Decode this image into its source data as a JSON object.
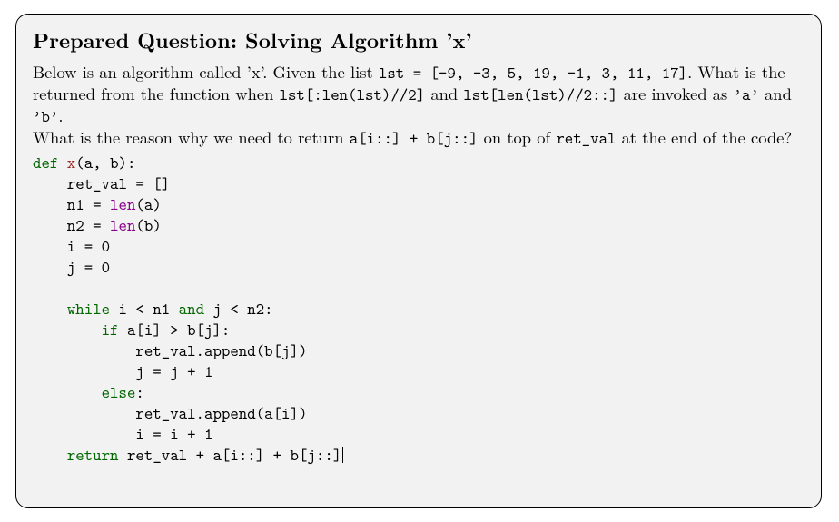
{
  "title": "Prepared Question: Solving Algorithm ’x’",
  "para1": {
    "t1": "Below is an algorithm called ’x’. Given the list ",
    "c1": "lst = [-9, -3, 5, 19, -1, 3, 11, 17]",
    "t2": ". What is the returned from the function when ",
    "c2": "lst[:len(lst)//2]",
    "t3": " and ",
    "c3": "lst[len(lst)//2::]",
    "t4": " are invoked as ",
    "c4": "’a’",
    "t5": " and ",
    "c5": "’b’",
    "t6": "."
  },
  "para2": {
    "t1": "What is the reason why we need to return ",
    "c1": "a[i::] + b[j::]",
    "t2": " on top of ",
    "c2": "ret_val",
    "t3": " at the end of the code?"
  },
  "code": {
    "l1_def": "def",
    "l1_name": " x",
    "l1_rest": "(a, b):",
    "l2": "    ret_val = []",
    "l3a": "    n1 = ",
    "l3b": "len",
    "l3c": "(a)",
    "l4a": "    n2 = ",
    "l4b": "len",
    "l4c": "(b)",
    "l5": "    i = 0",
    "l6": "    j = 0",
    "l7": "",
    "l8a": "    ",
    "l8b": "while",
    "l8c": " i < n1 ",
    "l8d": "and",
    "l8e": " j < n2:",
    "l9a": "        ",
    "l9b": "if",
    "l9c": " a[i] > b[j]:",
    "l10": "            ret_val.append(b[j])",
    "l11": "            j = j + 1",
    "l12a": "        ",
    "l12b": "else",
    "l12c": ":",
    "l13": "            ret_val.append(a[i])",
    "l14": "            i = i + 1",
    "l15a": "    ",
    "l15b": "return",
    "l15c": " ret_val + a[i::] + b[j::]"
  }
}
